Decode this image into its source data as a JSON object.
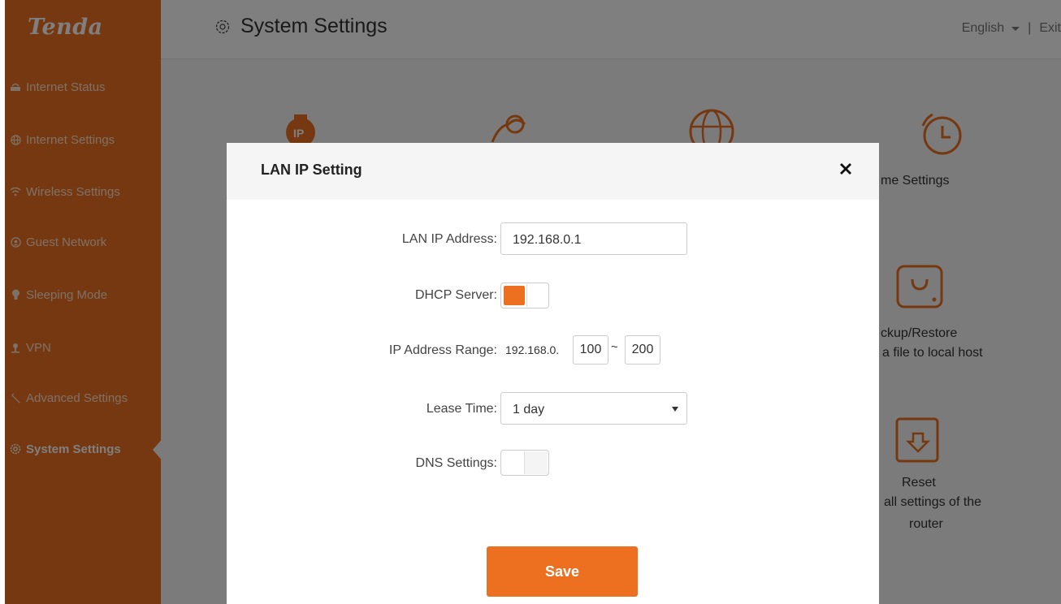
{
  "app": {
    "logo": "Tenda"
  },
  "sidebar": {
    "items": [
      {
        "label": "Internet Status",
        "icon": "router-icon"
      },
      {
        "label": "Internet Settings",
        "icon": "globe-icon"
      },
      {
        "label": "Wireless Settings",
        "icon": "wifi-icon"
      },
      {
        "label": "Guest Network",
        "icon": "guest-icon"
      },
      {
        "label": "Sleeping Mode",
        "icon": "bulb-icon"
      },
      {
        "label": "VPN",
        "icon": "vpn-icon"
      },
      {
        "label": "Advanced Settings",
        "icon": "wrench-icon"
      },
      {
        "label": "System Settings",
        "icon": "gear-icon",
        "active": true
      }
    ]
  },
  "header": {
    "title": "System Settings",
    "language": "English",
    "separator": "|",
    "exit": "Exit"
  },
  "tiles": {
    "time": {
      "title": "me Settings"
    },
    "backup": {
      "title": "ckup/Restore",
      "desc": "a file to local host"
    },
    "reset": {
      "title": "Reset",
      "desc1": "all settings of the",
      "desc2": "router"
    }
  },
  "modal": {
    "title": "LAN IP Setting",
    "lan_ip": {
      "label": "LAN IP Address:",
      "value": "192.168.0.1"
    },
    "dhcp": {
      "label": "DHCP Server:",
      "state": "on"
    },
    "ip_range": {
      "label": "IP Address Range:",
      "prefix": "192.168.0.",
      "start": "100",
      "sep": "~",
      "end": "200"
    },
    "lease": {
      "label": "Lease Time:",
      "value": "1 day"
    },
    "dns": {
      "label": "DNS Settings:",
      "state": "off"
    },
    "save_label": "Save"
  },
  "colors": {
    "accent": "#ed7020",
    "overlay": "rgba(0,0,0,0.5)"
  }
}
